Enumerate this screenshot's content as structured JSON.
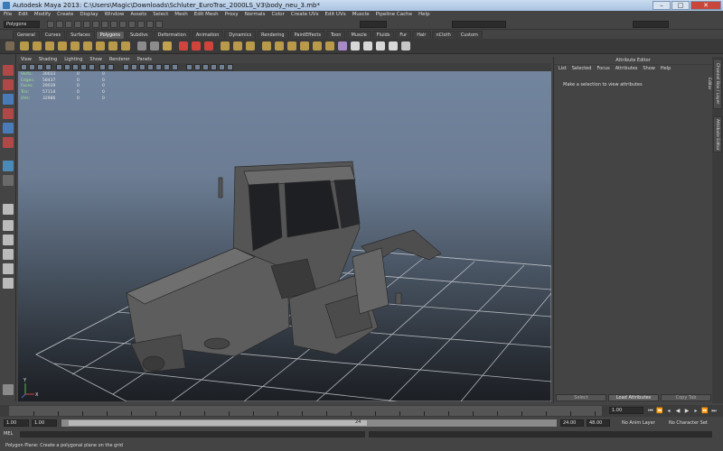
{
  "window": {
    "title": "Autodesk Maya 2013: C:\\Users\\Magic\\Downloads\\Schluter_EuroTrac_2000LS_V3\\body_neu_3.mb*",
    "minimize": "–",
    "maximize": "□",
    "close": "✕"
  },
  "menubar": [
    "File",
    "Edit",
    "Modify",
    "Create",
    "Display",
    "Window",
    "Assets",
    "Select",
    "Mesh",
    "Edit Mesh",
    "Proxy",
    "Normals",
    "Color",
    "Create UVs",
    "Edit UVs",
    "Muscle",
    "Pipeline Cache",
    "Help"
  ],
  "statusline": {
    "mode": "Polygons"
  },
  "shelf_tabs": [
    "General",
    "Curves",
    "Surfaces",
    "Polygons",
    "Subdivs",
    "Deformation",
    "Animation",
    "Dynamics",
    "Rendering",
    "PaintEffects",
    "Toon",
    "Muscle",
    "Fluids",
    "Fur",
    "Hair",
    "nCloth",
    "Custom"
  ],
  "shelf_active_tab": "Polygons",
  "viewport": {
    "menu": [
      "View",
      "Shading",
      "Lighting",
      "Show",
      "Renderer",
      "Panels"
    ],
    "hud": [
      {
        "label": "Verts:",
        "v1": "30033",
        "v2": "0",
        "v3": "0"
      },
      {
        "label": "Edges:",
        "v1": "58437",
        "v2": "0",
        "v3": "0"
      },
      {
        "label": "Faces:",
        "v1": "29039",
        "v2": "0",
        "v3": "0"
      },
      {
        "label": "Tris:",
        "v1": "57114",
        "v2": "0",
        "v3": "0"
      },
      {
        "label": "UVs:",
        "v1": "32986",
        "v2": "0",
        "v3": "0"
      }
    ],
    "axis_y": "Y",
    "axis_x": "X"
  },
  "attribute_editor": {
    "title": "Attribute Editor",
    "menu": [
      "List",
      "Selected",
      "Focus",
      "Attributes",
      "Show",
      "Help"
    ],
    "message": "Make a selection to view attributes",
    "buttons": [
      "Select",
      "Load Attributes",
      "Copy Tab"
    ]
  },
  "side_tabs": [
    "Channel Box / Layer Editor",
    "Attribute Editor"
  ],
  "time_slider": {
    "current_frame": "1.00"
  },
  "range": {
    "start": "1.00",
    "playback_start": "1.00",
    "range_marker": "24",
    "playback_end": "24.00",
    "end": "48.00",
    "anim_layer": "No Anim Layer",
    "character_set": "No Character Set"
  },
  "command_line": {
    "label": "MEL"
  },
  "help_line": "Polygon Plane: Create a polygonal plane on the grid"
}
